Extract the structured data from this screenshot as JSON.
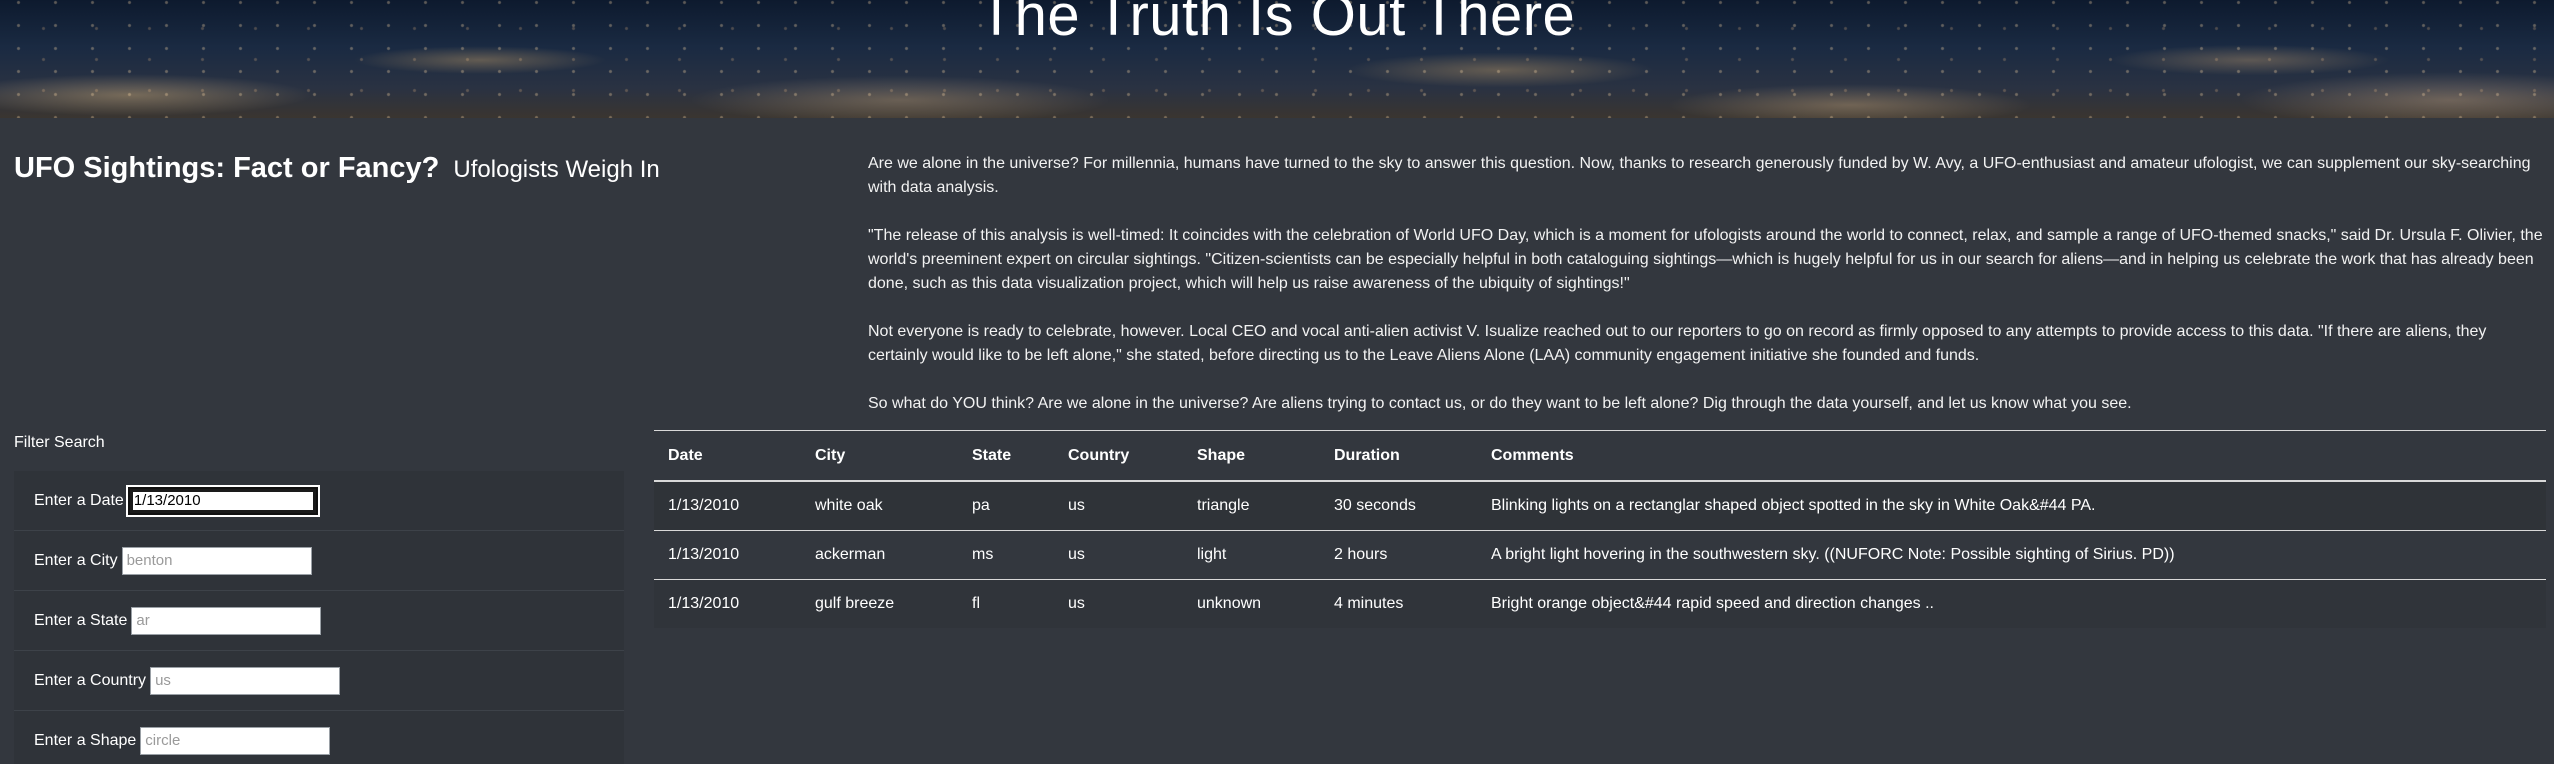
{
  "hero": {
    "title": "The Truth Is Out There"
  },
  "headline": {
    "main": "UFO Sightings: Fact or Fancy?",
    "sub": "Ufologists Weigh In"
  },
  "article": {
    "paragraphs": [
      "Are we alone in the universe? For millennia, humans have turned to the sky to answer this question. Now, thanks to research generously funded by W. Avy, a UFO-enthusiast and amateur ufologist, we can supplement our sky-searching with data analysis.",
      "\"The release of this analysis is well-timed: It coincides with the celebration of World UFO Day, which is a moment for ufologists around the world to connect, relax, and sample a range of UFO-themed snacks,\" said Dr. Ursula F. Olivier, the world's preeminent expert on circular sightings. \"Citizen-scientists can be especially helpful in both cataloguing sightings—which is hugely helpful for us in our search for aliens—and in helping us celebrate the work that has already been done, such as this data visualization project, which will help us raise awareness of the ubiquity of sightings!\"",
      "Not everyone is ready to celebrate, however. Local CEO and vocal anti-alien activist V. Isualize reached out to our reporters to go on record as firmly opposed to any attempts to provide access to this data. \"If there are aliens, they certainly would like to be left alone,\" she stated, before directing us to the Leave Aliens Alone (LAA) community engagement initiative she founded and funds.",
      "So what do YOU think? Are we alone in the universe? Are aliens trying to contact us, or do they want to be left alone? Dig through the data yourself, and let us know what you see."
    ]
  },
  "filter": {
    "title": "Filter Search",
    "fields": [
      {
        "label": "Enter a Date",
        "value": "1/13/2010",
        "placeholder": ""
      },
      {
        "label": "Enter a City",
        "value": "",
        "placeholder": "benton"
      },
      {
        "label": "Enter a State",
        "value": "",
        "placeholder": "ar"
      },
      {
        "label": "Enter a Country",
        "value": "",
        "placeholder": "us"
      },
      {
        "label": "Enter a Shape",
        "value": "",
        "placeholder": "circle"
      }
    ]
  },
  "table": {
    "columns": [
      "Date",
      "City",
      "State",
      "Country",
      "Shape",
      "Duration",
      "Comments"
    ],
    "rows": [
      [
        "1/13/2010",
        "white oak",
        "pa",
        "us",
        "triangle",
        "30 seconds",
        "Blinking lights on a rectanglar shaped object spotted in the sky in White Oak&#44 PA."
      ],
      [
        "1/13/2010",
        "ackerman",
        "ms",
        "us",
        "light",
        "2 hours",
        "A bright light hovering in the southwestern sky. ((NUFORC Note: Possible sighting of Sirius. PD))"
      ],
      [
        "1/13/2010",
        "gulf breeze",
        "fl",
        "us",
        "unknown",
        "4 minutes",
        "Bright orange object&#44 rapid speed and direction changes .."
      ]
    ]
  }
}
